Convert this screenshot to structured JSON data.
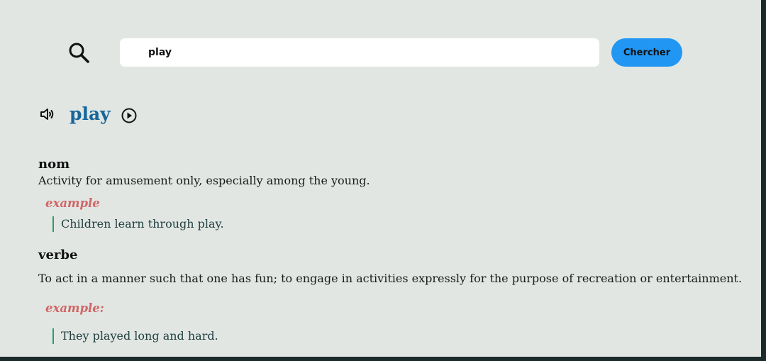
{
  "search": {
    "value": "play",
    "button_label": "Chercher"
  },
  "entry": {
    "word": "play",
    "meanings": [
      {
        "part_of_speech": "nom",
        "definition": "Activity for amusement only, especially among the young.",
        "example_label": "example",
        "example": "Children learn through play."
      },
      {
        "part_of_speech": "verbe",
        "definition": "To act in a manner such that one has fun; to engage in activities expressly for the purpose of recreation or entertainment.",
        "example_label": "example:",
        "example": "They played long and hard."
      }
    ]
  },
  "icons": {
    "search": "magnifier-icon",
    "audio": "speaker-icon",
    "play": "play-circle-icon"
  },
  "colors": {
    "background": "#e1e6e3",
    "accent_button": "#2196f3",
    "word_title": "#16669a",
    "example_label": "#d16666",
    "example_bar": "#2a9d6a"
  }
}
